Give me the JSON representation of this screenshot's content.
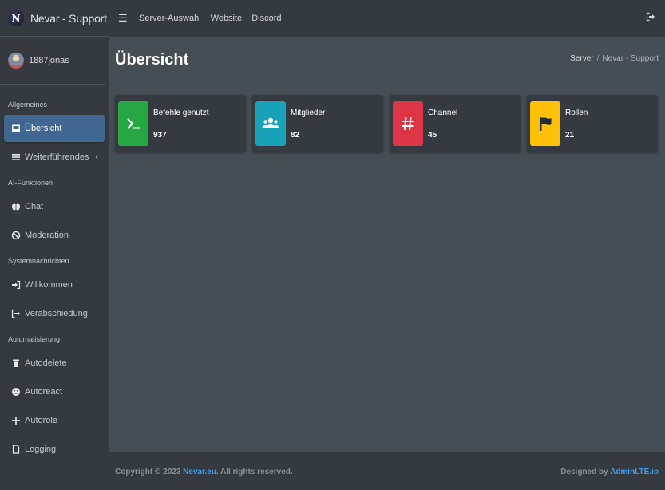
{
  "brand": {
    "logo_letter": "N",
    "name": "Nevar - Support"
  },
  "user": {
    "name": "1887jonas"
  },
  "sidebar": {
    "sections": [
      {
        "header": "Allgemeines",
        "items": [
          {
            "label": "Übersicht",
            "icon": "inbox-icon",
            "active": true
          },
          {
            "label": "Weiterführendes",
            "icon": "list-icon",
            "has_arrow": true
          }
        ]
      },
      {
        "header": "AI-Funktionen",
        "items": [
          {
            "label": "Chat",
            "icon": "brain-icon"
          },
          {
            "label": "Moderation",
            "icon": "ban-icon"
          }
        ]
      },
      {
        "header": "Systemnachrichten",
        "items": [
          {
            "label": "Willkommen",
            "icon": "sign-in-icon"
          },
          {
            "label": "Verabschiedung",
            "icon": "sign-out-icon"
          }
        ]
      },
      {
        "header": "Automatisierung",
        "items": [
          {
            "label": "Autodelete",
            "icon": "trash-icon"
          },
          {
            "label": "Autoreact",
            "icon": "smile-icon"
          },
          {
            "label": "Autorole",
            "icon": "plus-icon"
          },
          {
            "label": "Logging",
            "icon": "file-icon"
          }
        ]
      }
    ],
    "arrow_glyph": "‹"
  },
  "topbar": {
    "menu_glyph": "☰",
    "links": [
      "Server-Auswahl",
      "Website",
      "Discord"
    ]
  },
  "page": {
    "title": "Übersicht",
    "breadcrumb": {
      "root": "Server",
      "separator": "/",
      "current": "Nevar - Support"
    }
  },
  "cards": [
    {
      "label": "Befehle genutzt",
      "value": "937",
      "icon": "terminal-icon",
      "color": "#28a745"
    },
    {
      "label": "Mitglieder",
      "value": "82",
      "icon": "users-icon",
      "color": "#17a2b8"
    },
    {
      "label": "Channel",
      "value": "45",
      "icon": "hashtag-icon",
      "color": "#dc3545"
    },
    {
      "label": "Rollen",
      "value": "21",
      "icon": "flag-icon",
      "color": "#ffc107"
    }
  ],
  "footer": {
    "copyright_prefix": "Copyright © 2023 ",
    "copyright_link": "Nevar.eu",
    "copyright_suffix": ". All rights reserved.",
    "designed_prefix": "Designed by ",
    "designed_link": "AdminLTE.io"
  },
  "colors": {
    "sidebar_bg": "#343a40",
    "content_bg": "#454d55",
    "active_item": "#3f6791",
    "link": "#3f9cf3"
  }
}
